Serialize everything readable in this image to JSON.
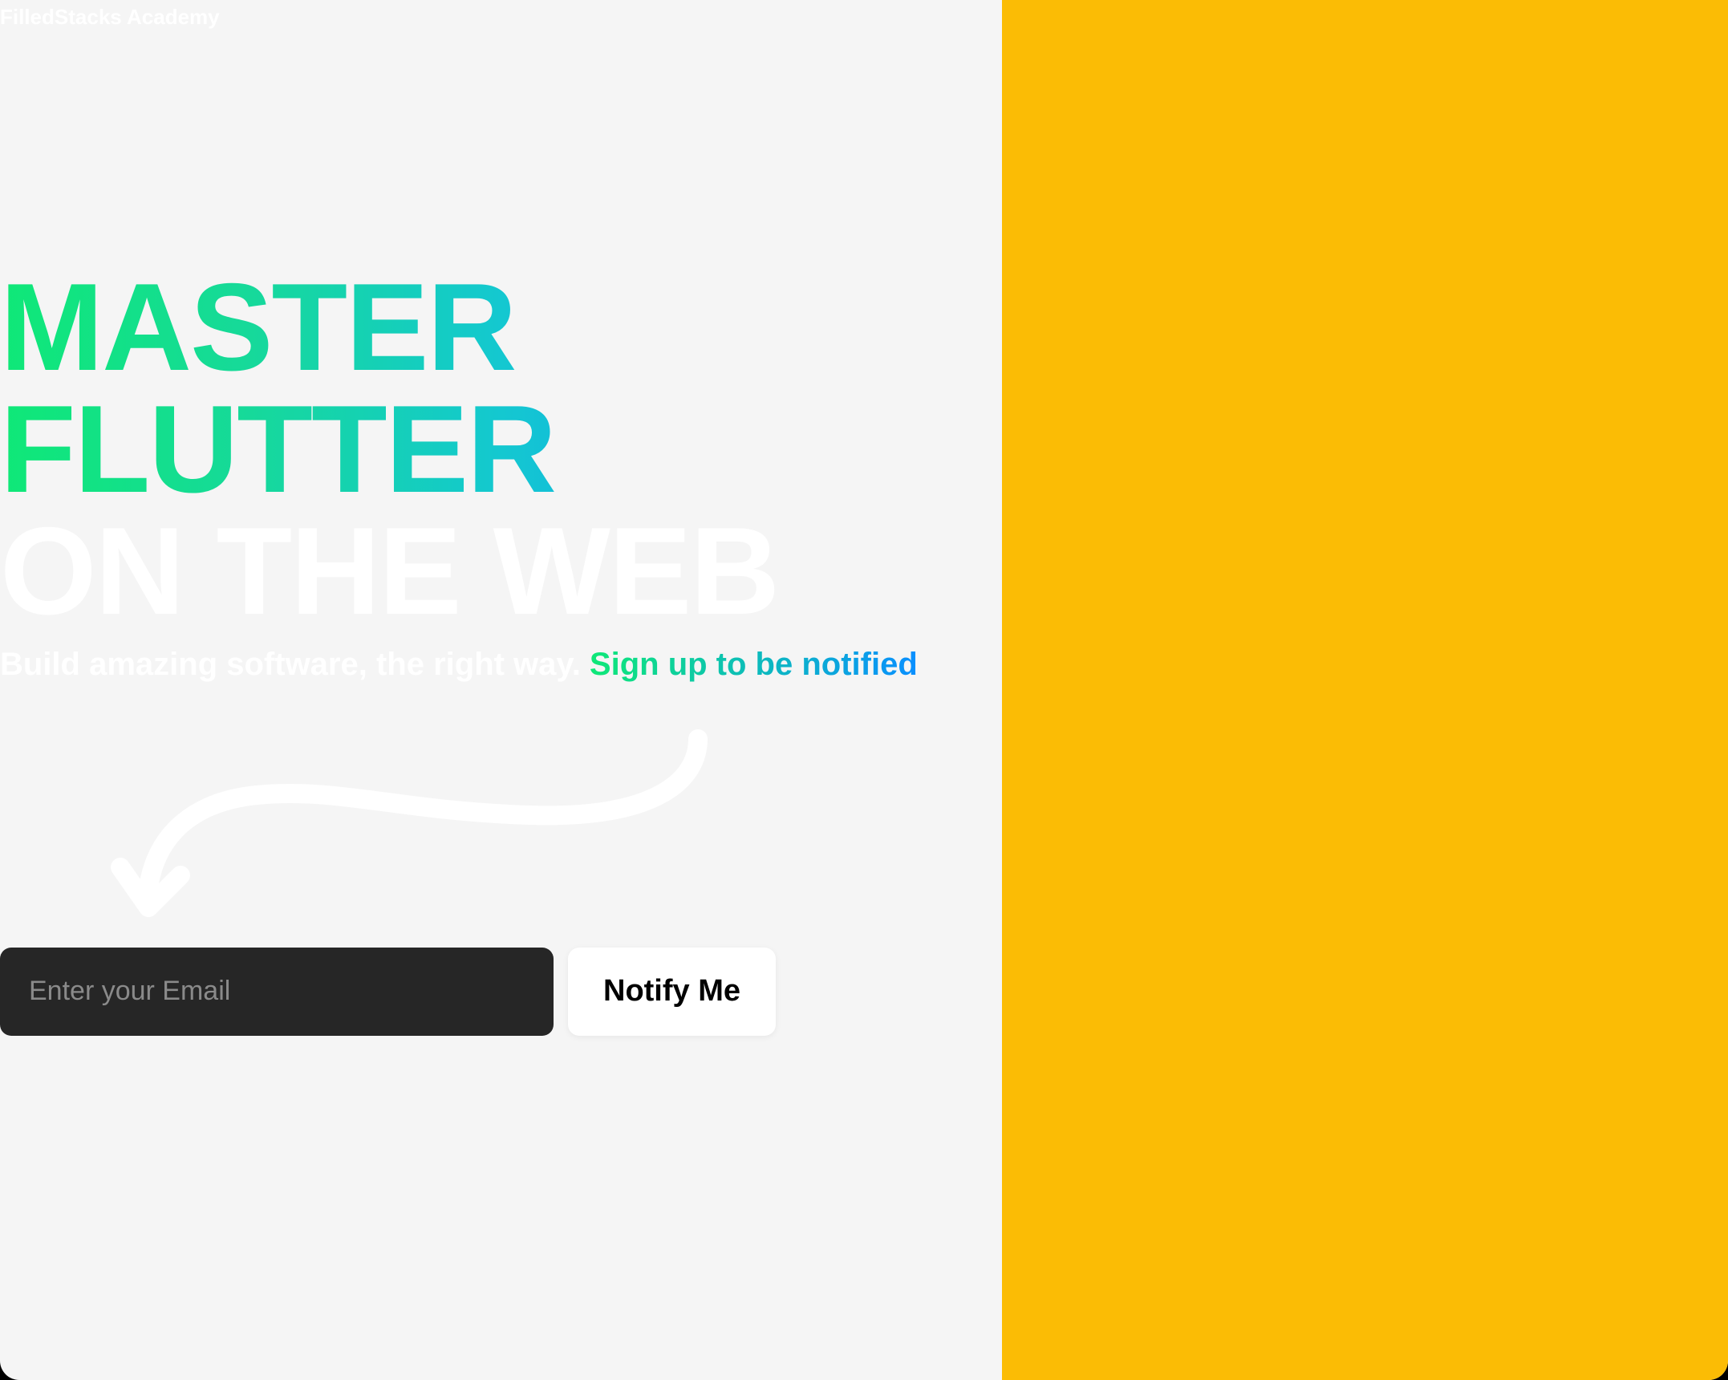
{
  "brand": {
    "title": "FilledStacks Academy"
  },
  "hero": {
    "line1": "MASTER",
    "line2": "FLUTTER",
    "line3": "ON THE WEB"
  },
  "subtitle": {
    "part1": "Build amazing software, the right way. ",
    "part2": "Sign up to be notified"
  },
  "form": {
    "email_placeholder": "Enter your Email",
    "button_label": "Notify Me"
  }
}
